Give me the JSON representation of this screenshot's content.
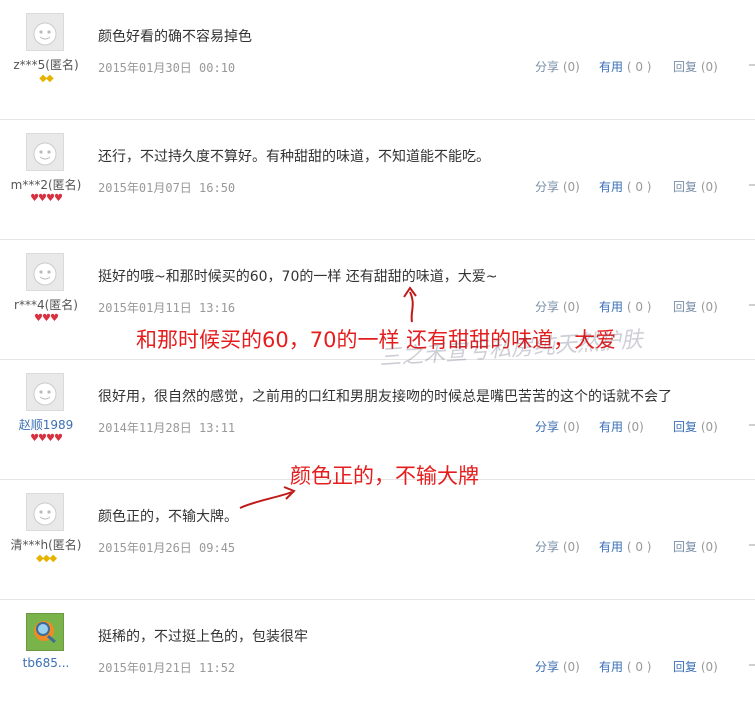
{
  "actions": {
    "share_label": "分享",
    "useful_label": "有用",
    "reply_label": "回复"
  },
  "reviews": [
    {
      "user": "z***5(匿名)",
      "rank": "gold",
      "rank_glyph": "◆◆",
      "content": "颜色好看的确不容易掉色",
      "date": "2015年01月30日 00:10",
      "share": "(0)",
      "useful": "( 0 )",
      "reply": "(0)"
    },
    {
      "user": "m***2(匿名)",
      "rank": "red",
      "rank_glyph": "♥♥♥♥",
      "content": "还行，不过持久度不算好。有种甜甜的味道，不知道能不能吃。",
      "date": "2015年01月07日 16:50",
      "share": "(0)",
      "useful": "( 0 )",
      "reply": "(0)"
    },
    {
      "user": "r***4(匿名)",
      "rank": "red",
      "rank_glyph": "♥♥♥",
      "content": "挺好的哦~和那时候买的60，70的一样 还有甜甜的味道，大爱~",
      "date": "2015年01月11日 13:16",
      "share": "(0)",
      "useful": "( 0 )",
      "reply": "(0)"
    },
    {
      "user": "赵顺1989",
      "rank": "red",
      "rank_glyph": "♥♥♥♥",
      "content": "很好用，很自然的感觉，之前用的口红和男朋友接吻的时候总是嘴巴苦苦的这个的话就不会了",
      "date": "2014年11月28日 13:11",
      "share": "(0)",
      "useful": "(0)",
      "reply": "(0)"
    },
    {
      "user": "清***h(匿名)",
      "rank": "gold",
      "rank_glyph": "◆◆◆",
      "content": "颜色正的，不输大牌。",
      "date": "2015年01月26日 09:45",
      "share": "(0)",
      "useful": "( 0 )",
      "reply": "(0)"
    },
    {
      "user": "tb685...",
      "rank": "none",
      "rank_glyph": "",
      "content": "挺稀的，不过挺上色的，包装很牢",
      "date": "2015年01月21日 11:52",
      "share": "(0)",
      "useful": "( 0 )",
      "reply": "(0)"
    }
  ],
  "annotations": {
    "note1": "和那时候买的60，70的一样   还有甜甜的味道，大爱",
    "note2": "颜色正的，不输大牌",
    "watermark": "三之禾宣亏私房纯天然护肤"
  },
  "colors": {
    "annotation": "#e51d1d",
    "link_blue": "#3b6fb6",
    "gold_rank": "#e7b300",
    "red_rank": "#d8313f"
  }
}
